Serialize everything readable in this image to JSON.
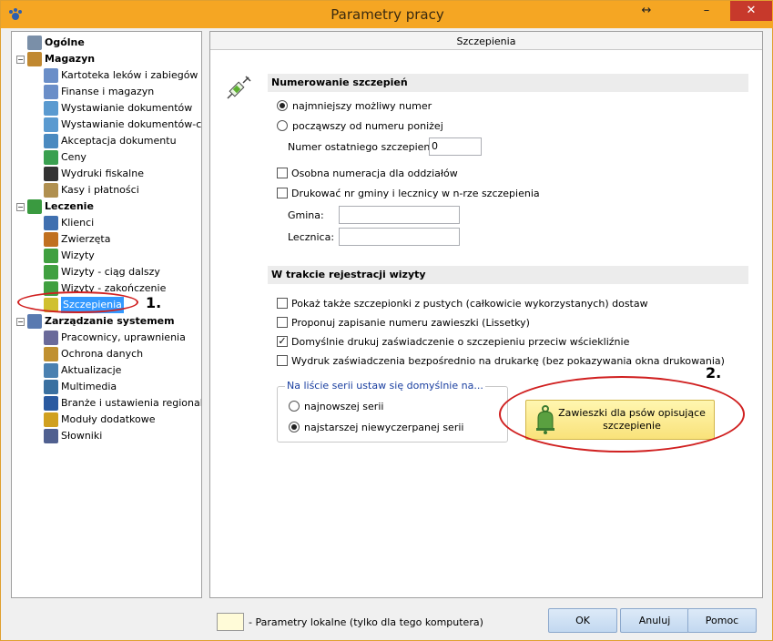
{
  "window": {
    "title": "Parametry pracy",
    "resize_glyph": "↔",
    "min_glyph": "–",
    "max_glyph": "□",
    "close_glyph": "✕"
  },
  "tree": {
    "items": [
      {
        "label": "Ogólne",
        "group": true,
        "icon": "computer-icon"
      },
      {
        "label": "Magazyn",
        "group": true,
        "icon": "warehouse-icon"
      },
      {
        "label": "Kartoteka leków i zabiegów",
        "icon": "document-icon"
      },
      {
        "label": "Finanse i magazyn",
        "icon": "document-icon"
      },
      {
        "label": "Wystawianie dokumentów",
        "icon": "document-edit-icon"
      },
      {
        "label": "Wystawianie dokumentów-c.d.",
        "icon": "document-edit-icon"
      },
      {
        "label": "Akceptacja dokumentu",
        "icon": "document-check-icon"
      },
      {
        "label": "Ceny",
        "icon": "price-icon"
      },
      {
        "label": "Wydruki fiskalne",
        "icon": "printer-icon"
      },
      {
        "label": "Kasy i płatności",
        "icon": "cash-icon"
      },
      {
        "label": "Leczenie",
        "group": true,
        "icon": "treatment-icon"
      },
      {
        "label": "Klienci",
        "icon": "person-icon"
      },
      {
        "label": "Zwierzęta",
        "icon": "animal-icon"
      },
      {
        "label": "Wizyty",
        "icon": "visit-icon"
      },
      {
        "label": "Wizyty - ciąg dalszy",
        "icon": "visit-icon"
      },
      {
        "label": "Wizyty - zakończenie",
        "icon": "visit-icon"
      },
      {
        "label": "Szczepienia",
        "icon": "syringe-icon",
        "selected": true
      },
      {
        "label": "Zarządzanie systemem",
        "group": true,
        "icon": "system-icon"
      },
      {
        "label": "Pracownicy, uprawnienia",
        "icon": "users-icon"
      },
      {
        "label": "Ochrona danych",
        "icon": "lock-icon"
      },
      {
        "label": "Aktualizacje",
        "icon": "update-icon"
      },
      {
        "label": "Multimedia",
        "icon": "multimedia-icon"
      },
      {
        "label": "Branże i ustawienia regionalne",
        "icon": "region-icon"
      },
      {
        "label": "Moduły dodatkowe",
        "icon": "modules-icon"
      },
      {
        "label": "Słowniki",
        "icon": "dictionary-icon"
      }
    ]
  },
  "panel": {
    "header": "Szczepienia",
    "section1": "Numerowanie szczepień",
    "radio_min": "najmniejszy możliwy numer",
    "radio_from": "począwszy od numeru poniżej",
    "last_number_label": "Numer ostatniego szczepienia",
    "last_number_value": "0",
    "separate_numbering": "Osobna numeracja dla oddziałów",
    "print_commune": "Drukować nr gminy i lecznicy w n-rze szczepienia",
    "gmina_label": "Gmina:",
    "gmina_value": "",
    "lecznica_label": "Lecznica:",
    "lecznica_value": "",
    "section2": "W trakcie rejestracji wizyty",
    "show_empty": "Pokaż także szczepionki z pustych (całkowicie wykorzystanych) dostaw",
    "propose_tag": "Proponuj zapisanie numeru zawieszki (Lissetky)",
    "default_print": "Domyślnie drukuj zaświadczenie o szczepieniu przeciw wściekliźnie",
    "direct_print": "Wydruk zaświadczenia bezpośrednio na drukarkę (bez pokazywania okna drukowania)",
    "series_group_title": "Na liście serii ustaw się domyślnie na...",
    "series_newest": "najnowszej serii",
    "series_oldest": "najstarszej niewyczerpanej serii",
    "tags_button": "Zawieszki dla psów opisujące szczepienie"
  },
  "annotations": {
    "one": "1.",
    "two": "2."
  },
  "footer": {
    "legend": "- Parametry lokalne (tylko dla tego komputera)",
    "ok": "OK",
    "cancel": "Anuluj",
    "help": "Pomoc"
  },
  "colors": {
    "accent": "#f5a623",
    "selection": "#3399ff",
    "annotation": "#d02020"
  }
}
